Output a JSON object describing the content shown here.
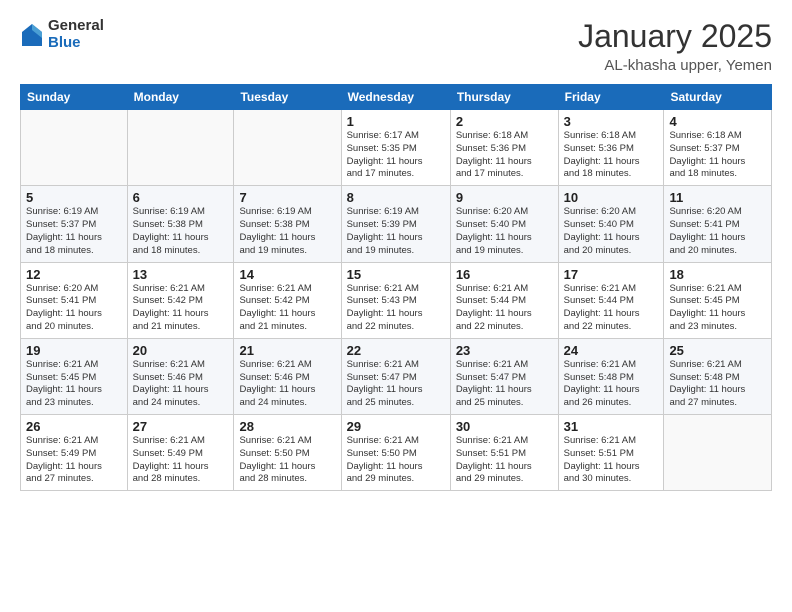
{
  "logo": {
    "general": "General",
    "blue": "Blue"
  },
  "header": {
    "month": "January 2025",
    "location": "AL-khasha upper, Yemen"
  },
  "weekdays": [
    "Sunday",
    "Monday",
    "Tuesday",
    "Wednesday",
    "Thursday",
    "Friday",
    "Saturday"
  ],
  "weeks": [
    [
      {
        "day": "",
        "info": ""
      },
      {
        "day": "",
        "info": ""
      },
      {
        "day": "",
        "info": ""
      },
      {
        "day": "1",
        "info": "Sunrise: 6:17 AM\nSunset: 5:35 PM\nDaylight: 11 hours\nand 17 minutes."
      },
      {
        "day": "2",
        "info": "Sunrise: 6:18 AM\nSunset: 5:36 PM\nDaylight: 11 hours\nand 17 minutes."
      },
      {
        "day": "3",
        "info": "Sunrise: 6:18 AM\nSunset: 5:36 PM\nDaylight: 11 hours\nand 18 minutes."
      },
      {
        "day": "4",
        "info": "Sunrise: 6:18 AM\nSunset: 5:37 PM\nDaylight: 11 hours\nand 18 minutes."
      }
    ],
    [
      {
        "day": "5",
        "info": "Sunrise: 6:19 AM\nSunset: 5:37 PM\nDaylight: 11 hours\nand 18 minutes."
      },
      {
        "day": "6",
        "info": "Sunrise: 6:19 AM\nSunset: 5:38 PM\nDaylight: 11 hours\nand 18 minutes."
      },
      {
        "day": "7",
        "info": "Sunrise: 6:19 AM\nSunset: 5:38 PM\nDaylight: 11 hours\nand 19 minutes."
      },
      {
        "day": "8",
        "info": "Sunrise: 6:19 AM\nSunset: 5:39 PM\nDaylight: 11 hours\nand 19 minutes."
      },
      {
        "day": "9",
        "info": "Sunrise: 6:20 AM\nSunset: 5:40 PM\nDaylight: 11 hours\nand 19 minutes."
      },
      {
        "day": "10",
        "info": "Sunrise: 6:20 AM\nSunset: 5:40 PM\nDaylight: 11 hours\nand 20 minutes."
      },
      {
        "day": "11",
        "info": "Sunrise: 6:20 AM\nSunset: 5:41 PM\nDaylight: 11 hours\nand 20 minutes."
      }
    ],
    [
      {
        "day": "12",
        "info": "Sunrise: 6:20 AM\nSunset: 5:41 PM\nDaylight: 11 hours\nand 20 minutes."
      },
      {
        "day": "13",
        "info": "Sunrise: 6:21 AM\nSunset: 5:42 PM\nDaylight: 11 hours\nand 21 minutes."
      },
      {
        "day": "14",
        "info": "Sunrise: 6:21 AM\nSunset: 5:42 PM\nDaylight: 11 hours\nand 21 minutes."
      },
      {
        "day": "15",
        "info": "Sunrise: 6:21 AM\nSunset: 5:43 PM\nDaylight: 11 hours\nand 22 minutes."
      },
      {
        "day": "16",
        "info": "Sunrise: 6:21 AM\nSunset: 5:44 PM\nDaylight: 11 hours\nand 22 minutes."
      },
      {
        "day": "17",
        "info": "Sunrise: 6:21 AM\nSunset: 5:44 PM\nDaylight: 11 hours\nand 22 minutes."
      },
      {
        "day": "18",
        "info": "Sunrise: 6:21 AM\nSunset: 5:45 PM\nDaylight: 11 hours\nand 23 minutes."
      }
    ],
    [
      {
        "day": "19",
        "info": "Sunrise: 6:21 AM\nSunset: 5:45 PM\nDaylight: 11 hours\nand 23 minutes."
      },
      {
        "day": "20",
        "info": "Sunrise: 6:21 AM\nSunset: 5:46 PM\nDaylight: 11 hours\nand 24 minutes."
      },
      {
        "day": "21",
        "info": "Sunrise: 6:21 AM\nSunset: 5:46 PM\nDaylight: 11 hours\nand 24 minutes."
      },
      {
        "day": "22",
        "info": "Sunrise: 6:21 AM\nSunset: 5:47 PM\nDaylight: 11 hours\nand 25 minutes."
      },
      {
        "day": "23",
        "info": "Sunrise: 6:21 AM\nSunset: 5:47 PM\nDaylight: 11 hours\nand 25 minutes."
      },
      {
        "day": "24",
        "info": "Sunrise: 6:21 AM\nSunset: 5:48 PM\nDaylight: 11 hours\nand 26 minutes."
      },
      {
        "day": "25",
        "info": "Sunrise: 6:21 AM\nSunset: 5:48 PM\nDaylight: 11 hours\nand 27 minutes."
      }
    ],
    [
      {
        "day": "26",
        "info": "Sunrise: 6:21 AM\nSunset: 5:49 PM\nDaylight: 11 hours\nand 27 minutes."
      },
      {
        "day": "27",
        "info": "Sunrise: 6:21 AM\nSunset: 5:49 PM\nDaylight: 11 hours\nand 28 minutes."
      },
      {
        "day": "28",
        "info": "Sunrise: 6:21 AM\nSunset: 5:50 PM\nDaylight: 11 hours\nand 28 minutes."
      },
      {
        "day": "29",
        "info": "Sunrise: 6:21 AM\nSunset: 5:50 PM\nDaylight: 11 hours\nand 29 minutes."
      },
      {
        "day": "30",
        "info": "Sunrise: 6:21 AM\nSunset: 5:51 PM\nDaylight: 11 hours\nand 29 minutes."
      },
      {
        "day": "31",
        "info": "Sunrise: 6:21 AM\nSunset: 5:51 PM\nDaylight: 11 hours\nand 30 minutes."
      },
      {
        "day": "",
        "info": ""
      }
    ]
  ]
}
